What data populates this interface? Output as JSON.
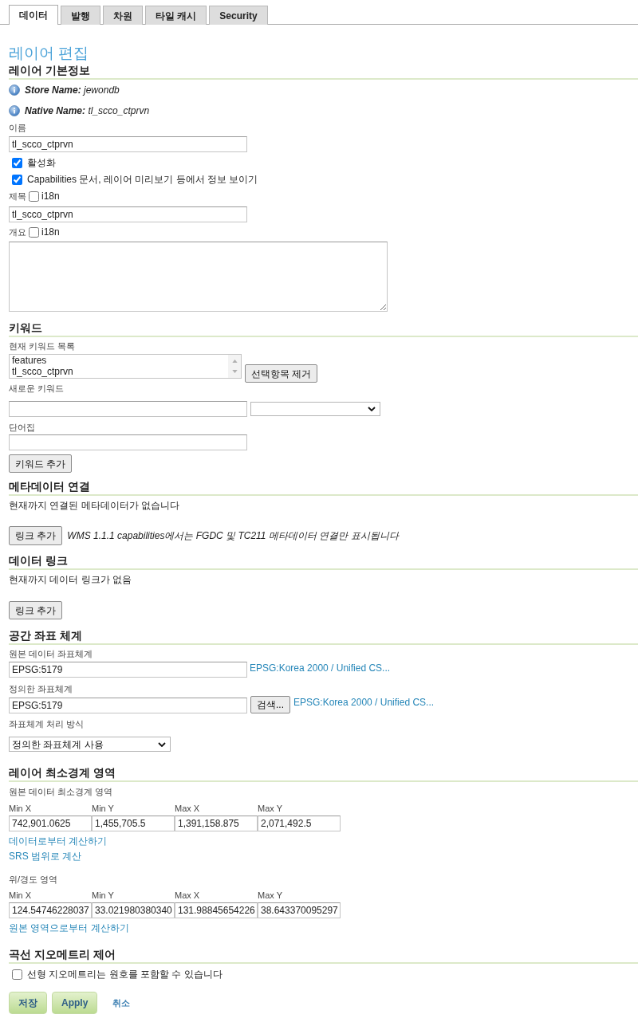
{
  "tabs": [
    {
      "label": "데이터",
      "selected": true
    },
    {
      "label": "발행",
      "selected": false
    },
    {
      "label": "차원",
      "selected": false
    },
    {
      "label": "타일 캐시",
      "selected": false
    },
    {
      "label": "Security",
      "selected": false
    }
  ],
  "page_title": "레이어 편집",
  "basic_info": {
    "heading": "레이어 기본정보",
    "info": [
      {
        "label": "Store Name:",
        "value": "jewondb"
      },
      {
        "label": "Native Name:",
        "value": "tl_scco_ctprvn"
      }
    ],
    "name": {
      "label": "이름",
      "value": "tl_scco_ctprvn"
    },
    "options": [
      {
        "label": "활성화",
        "checked": true
      },
      {
        "label": "Capabilities 문서, 레이어 미리보기 등에서 정보 보이기",
        "checked": true
      }
    ],
    "title": {
      "label": "제목",
      "i18n": {
        "label": "i18n",
        "checked": false
      },
      "value": "tl_scco_ctprvn"
    },
    "abstract": {
      "label": "개요",
      "i18n": {
        "label": "i18n",
        "checked": false
      }
    }
  },
  "keywords": {
    "heading": "키워드",
    "current_label": "현재 키워드 목록",
    "current": [
      {
        "text": "features",
        "selected": false
      },
      {
        "text": "tl_scco_ctprvn",
        "selected": false
      }
    ],
    "remove_button": "선택항목 제거",
    "new_label": "새로운 키워드",
    "vocabulary_label": "단어집",
    "add_button": "키워드 추가"
  },
  "metadata_links": {
    "heading": "메타데이터 연결",
    "empty_text": "현재까지 연결된 메타데이터가 없습니다",
    "add_button": "링크 추가",
    "note": "WMS 1.1.1 capabilities에서는 FGDC 및 TC211 메타데이터 연결만 표시됩니다"
  },
  "data_links": {
    "heading": "데이터 링크",
    "empty_text": "현재까지 데이터 링크가 없음",
    "add_button": "링크 추가"
  },
  "crs": {
    "heading": "공간 좌표 체계",
    "native": {
      "label": "원본 데이터 좌표체계",
      "value": "EPSG:5179",
      "link": "EPSG:Korea 2000 / Unified CS..."
    },
    "declared": {
      "label": "정의한 좌표체계",
      "value": "EPSG:5179",
      "button": "검색...",
      "link": "EPSG:Korea 2000 / Unified CS..."
    },
    "policy": {
      "label": "좌표체계 처리 방식",
      "value": "정의한 좌표체계 사용"
    }
  },
  "bounding_boxes": {
    "heading": "레이어 최소경계 영역",
    "native": {
      "label": "원본 데이터 최소경계 영역",
      "fields": [
        {
          "label": "Min X",
          "value": "742,901.0625"
        },
        {
          "label": "Min Y",
          "value": "1,455,705.5"
        },
        {
          "label": "Max X",
          "value": "1,391,158.875"
        },
        {
          "label": "Max Y",
          "value": "2,071,492.5"
        }
      ],
      "links": [
        "데이터로부터 계산하기",
        "SRS 범위로 계산"
      ]
    },
    "latlon": {
      "label": "위/경도 영역",
      "fields": [
        {
          "label": "Min X",
          "value": "124.54746228037"
        },
        {
          "label": "Min Y",
          "value": "33.021980380340"
        },
        {
          "label": "Max X",
          "value": "131.98845654226"
        },
        {
          "label": "Max Y",
          "value": "38.643370095297"
        }
      ],
      "links": [
        "원본 영역으로부터 계산하기"
      ]
    }
  },
  "curves": {
    "heading": "곡선 지오메트리 제어",
    "option": {
      "label": "선형 지오메트리는 원호를 포함할 수 있습니다",
      "checked": false
    }
  },
  "actions": [
    {
      "label": "저장",
      "kind": "button"
    },
    {
      "label": "Apply",
      "kind": "button"
    },
    {
      "label": "취소",
      "kind": "link"
    }
  ]
}
